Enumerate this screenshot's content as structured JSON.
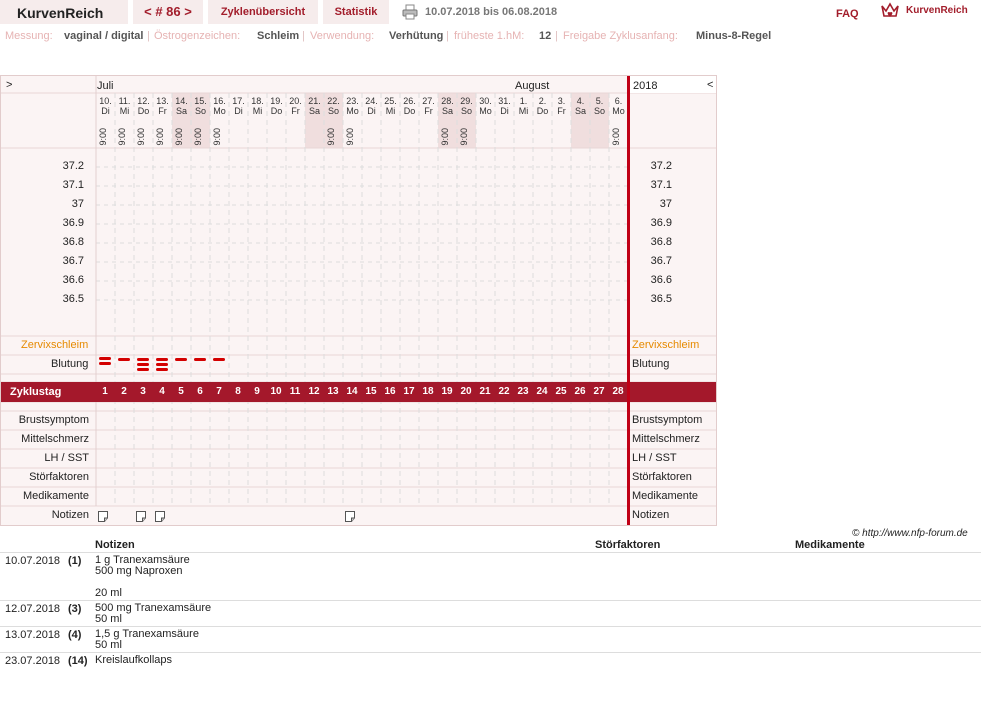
{
  "header": {
    "logo": "KurvenReich",
    "cycle_nav": "< # 86 >",
    "nav_overview": "Zyklenübersicht",
    "nav_statistics": "Statistik",
    "print_icon": "printer-icon",
    "date_range": "10.07.2018 bis 06.08.2018",
    "faq": "FAQ",
    "brand": "KurvenReich",
    "brand_icon": "crown-heart-icon"
  },
  "info": {
    "messung_label": "Messung:",
    "messung_value": "vaginal / digital",
    "oestrogen_label": "Östrogenzeichen:",
    "oestrogen_value": "Schleim",
    "verwendung_label": "Verwendung:",
    "verwendung_value": "Verhütung",
    "hm_label": "früheste 1.hM:",
    "hm_value": "12",
    "freigabe_label": "Freigabe Zyklusanfang:",
    "freigabe_value": "Minus-8-Regel"
  },
  "chart": {
    "prev": ">",
    "next": "<",
    "month1": "Juli",
    "month2": "August",
    "year": "2018",
    "days": [
      {
        "d": "10.",
        "w": "Di",
        "t": "9:00",
        "we": false
      },
      {
        "d": "11.",
        "w": "Mi",
        "t": "9:00",
        "we": false
      },
      {
        "d": "12.",
        "w": "Do",
        "t": "9:00",
        "we": false
      },
      {
        "d": "13.",
        "w": "Fr",
        "t": "9:00",
        "we": false
      },
      {
        "d": "14.",
        "w": "Sa",
        "t": "9:00",
        "we": true
      },
      {
        "d": "15.",
        "w": "So",
        "t": "9:00",
        "we": true
      },
      {
        "d": "16.",
        "w": "Mo",
        "t": "9:00",
        "we": false
      },
      {
        "d": "17.",
        "w": "Di",
        "t": "",
        "we": false
      },
      {
        "d": "18.",
        "w": "Mi",
        "t": "",
        "we": false
      },
      {
        "d": "19.",
        "w": "Do",
        "t": "",
        "we": false
      },
      {
        "d": "20.",
        "w": "Fr",
        "t": "",
        "we": false
      },
      {
        "d": "21.",
        "w": "Sa",
        "t": "",
        "we": true
      },
      {
        "d": "22.",
        "w": "So",
        "t": "9:00",
        "we": true
      },
      {
        "d": "23.",
        "w": "Mo",
        "t": "9:00",
        "we": false
      },
      {
        "d": "24.",
        "w": "Di",
        "t": "",
        "we": false
      },
      {
        "d": "25.",
        "w": "Mi",
        "t": "",
        "we": false
      },
      {
        "d": "26.",
        "w": "Do",
        "t": "",
        "we": false
      },
      {
        "d": "27.",
        "w": "Fr",
        "t": "",
        "we": false
      },
      {
        "d": "28.",
        "w": "Sa",
        "t": "9:00",
        "we": true
      },
      {
        "d": "29.",
        "w": "So",
        "t": "9:00",
        "we": true
      },
      {
        "d": "30.",
        "w": "Mo",
        "t": "",
        "we": false
      },
      {
        "d": "31.",
        "w": "Di",
        "t": "",
        "we": false
      },
      {
        "d": "1.",
        "w": "Mi",
        "t": "",
        "we": false
      },
      {
        "d": "2.",
        "w": "Do",
        "t": "",
        "we": false
      },
      {
        "d": "3.",
        "w": "Fr",
        "t": "",
        "we": false
      },
      {
        "d": "4.",
        "w": "Sa",
        "t": "",
        "we": true
      },
      {
        "d": "5.",
        "w": "So",
        "t": "",
        "we": true
      },
      {
        "d": "6.",
        "w": "Mo",
        "t": "9:00",
        "we": false
      }
    ],
    "temps": [
      "37.2",
      "37.1",
      "37",
      "36.9",
      "36.8",
      "36.7",
      "36.6",
      "36.5"
    ],
    "row_zervix": "Zervixschleim",
    "row_blutung": "Blutung",
    "row_zyklustag": "Zyklustag",
    "cycle_days": [
      1,
      2,
      3,
      4,
      5,
      6,
      7,
      8,
      9,
      10,
      11,
      12,
      13,
      14,
      15,
      16,
      17,
      18,
      19,
      20,
      21,
      22,
      23,
      24,
      25,
      26,
      27,
      28
    ],
    "bleeding_strokes": [
      2,
      1,
      3,
      3,
      1,
      1,
      1,
      0,
      0,
      0,
      0,
      0,
      0,
      0,
      0,
      0,
      0,
      0,
      0,
      0,
      0,
      0,
      0,
      0,
      0,
      0,
      0,
      0
    ],
    "note_days": [
      1,
      3,
      4,
      14
    ],
    "rows_bottom": [
      "Brustsymptom",
      "Mittelschmerz",
      "LH / SST",
      "Störfaktoren",
      "Medikamente",
      "Notizen"
    ],
    "color_accent": "#a4182b",
    "color_zervix": "#e68a00"
  },
  "footer": {
    "copyright": "© http://www.nfp-forum.de",
    "col_notizen": "Notizen",
    "col_stoer": "Störfaktoren",
    "col_medi": "Medikamente",
    "rows": [
      {
        "date": "10.07.2018",
        "num": "(1)",
        "text": "1 g Tranexamsäure\n500 mg Naproxen\n\n20 ml"
      },
      {
        "date": "12.07.2018",
        "num": "(3)",
        "text": "500 mg Tranexamsäure\n50 ml"
      },
      {
        "date": "13.07.2018",
        "num": "(4)",
        "text": "1,5 g Tranexamsäure\n50 ml"
      },
      {
        "date": "23.07.2018",
        "num": "(14)",
        "text": "Kreislaufkollaps"
      }
    ]
  }
}
